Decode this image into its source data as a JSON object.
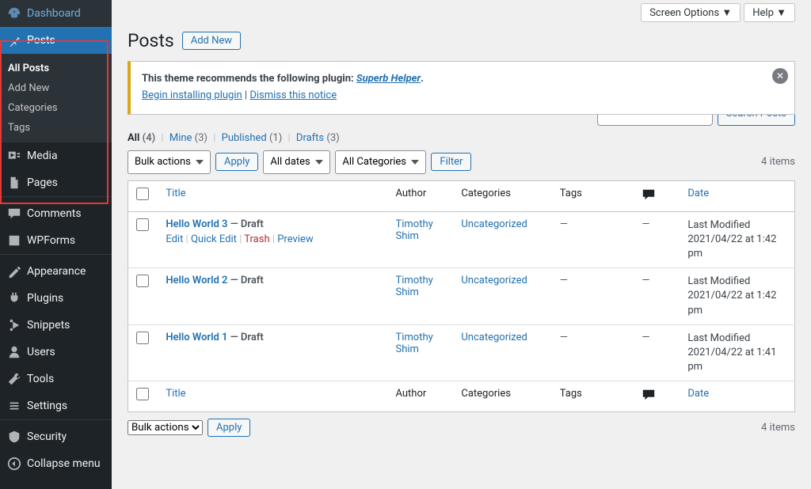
{
  "topbar": {
    "screen_options": "Screen Options ▼",
    "help": "Help ▼"
  },
  "sidebar": {
    "dashboard": "Dashboard",
    "posts": "Posts",
    "submenu": {
      "all": "All Posts",
      "add": "Add New",
      "cats": "Categories",
      "tags": "Tags"
    },
    "media": "Media",
    "pages": "Pages",
    "comments": "Comments",
    "wpforms": "WPForms",
    "appearance": "Appearance",
    "plugins": "Plugins",
    "snippets": "Snippets",
    "users": "Users",
    "tools": "Tools",
    "settings": "Settings",
    "security": "Security",
    "collapse": "Collapse menu"
  },
  "heading": {
    "title": "Posts",
    "add_new": "Add New"
  },
  "notice": {
    "line1_a": "This theme recommends the following plugin: ",
    "line1_link": "Superb Helper",
    "line1_b": ".",
    "install": "Begin installing plugin",
    "sep": " | ",
    "dismiss": "Dismiss this notice"
  },
  "filters": {
    "all": "All",
    "all_cnt": "(4)",
    "mine": "Mine",
    "mine_cnt": "(3)",
    "published": "Published",
    "published_cnt": "(1)",
    "drafts": "Drafts",
    "drafts_cnt": "(3)"
  },
  "search": {
    "button": "Search Posts"
  },
  "bulk": {
    "label": "Bulk actions",
    "apply": "Apply",
    "dates": "All dates",
    "cats": "All Categories",
    "filter": "Filter"
  },
  "count": "4 items",
  "cols": {
    "title": "Title",
    "author": "Author",
    "categories": "Categories",
    "tags": "Tags",
    "date": "Date"
  },
  "rowactions": {
    "edit": "Edit",
    "quick": "Quick Edit",
    "trash": "Trash",
    "preview": "Preview"
  },
  "rows": [
    {
      "title": "Hello World 3",
      "state": " — Draft",
      "author": "Timothy Shim",
      "cat": "Uncategorized",
      "tags": "—",
      "com": "—",
      "date_a": "Last Modified",
      "date_b": "2021/04/22 at 1:42 pm"
    },
    {
      "title": "Hello World 2",
      "state": " — Draft",
      "author": "Timothy Shim",
      "cat": "Uncategorized",
      "tags": "—",
      "com": "—",
      "date_a": "Last Modified",
      "date_b": "2021/04/22 at 1:42 pm"
    },
    {
      "title": "Hello World 1",
      "state": " — Draft",
      "author": "Timothy Shim",
      "cat": "Uncategorized",
      "tags": "—",
      "com": "—",
      "date_a": "Last Modified",
      "date_b": "2021/04/22 at 1:41 pm"
    }
  ]
}
